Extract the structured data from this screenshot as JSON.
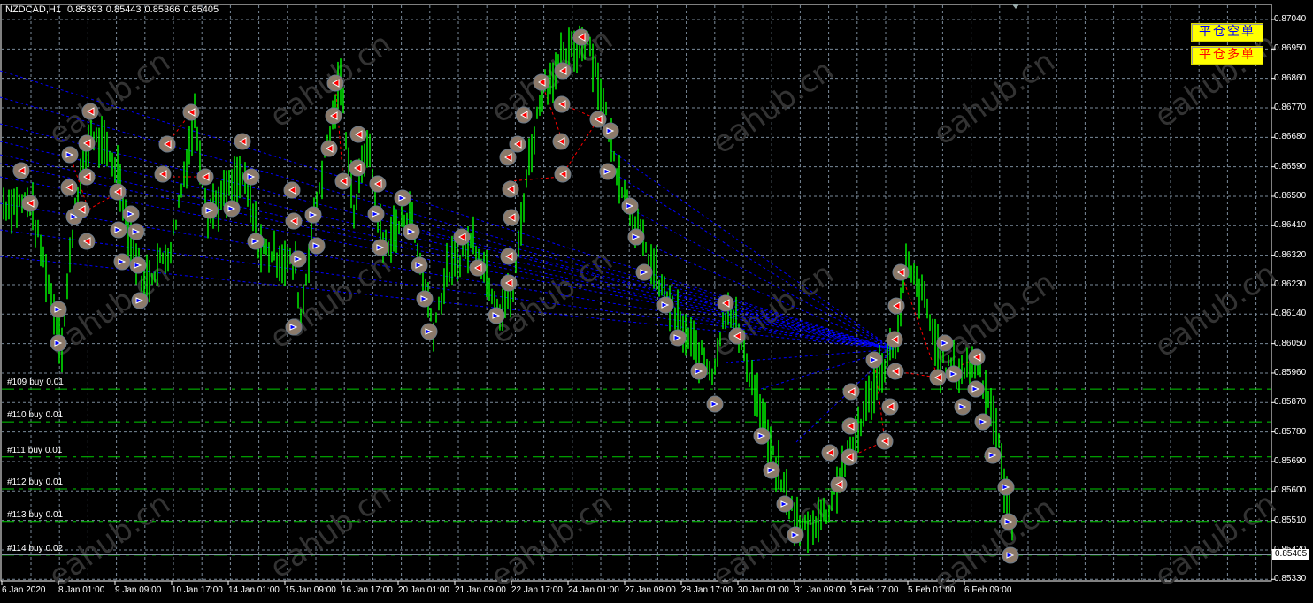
{
  "header": {
    "symbol": "NZDCAD,H1",
    "open": "0.85393",
    "high": "0.85443",
    "low": "0.85366",
    "close": "0.85405"
  },
  "buttons": {
    "close_short": "平仓空单",
    "close_long": "平仓多单"
  },
  "price_axis": [
    "0.87040",
    "0.86950",
    "0.86860",
    "0.86770",
    "0.86680",
    "0.86590",
    "0.86500",
    "0.86410",
    "0.86320",
    "0.86230",
    "0.86140",
    "0.86050",
    "0.85960",
    "0.85870",
    "0.85780",
    "0.85690",
    "0.85600",
    "0.85510",
    "0.85420",
    "0.85330"
  ],
  "current_price": "0.85405",
  "time_axis": [
    "6 Jan 2020",
    "8 Jan 01:00",
    "9 Jan 09:00",
    "10 Jan 17:00",
    "14 Jan 01:00",
    "15 Jan 09:00",
    "16 Jan 17:00",
    "20 Jan 01:00",
    "21 Jan 09:00",
    "22 Jan 17:00",
    "24 Jan 01:00",
    "27 Jan 09:00",
    "28 Jan 17:00",
    "30 Jan 01:00",
    "31 Jan 09:00",
    "3 Feb 17:00",
    "5 Feb 01:00",
    "6 Feb 09:00"
  ],
  "orders": [
    {
      "ticket": "#109",
      "type": "buy",
      "lots": "0.01",
      "price": 0.85911
    },
    {
      "ticket": "#110",
      "type": "buy",
      "lots": "0.01",
      "price": 0.85811
    },
    {
      "ticket": "#111",
      "type": "buy",
      "lots": "0.01",
      "price": 0.85704
    },
    {
      "ticket": "#112",
      "type": "buy",
      "lots": "0.01",
      "price": 0.85606
    },
    {
      "ticket": "#113",
      "type": "buy",
      "lots": "0.01",
      "price": 0.85507
    },
    {
      "ticket": "#114",
      "type": "buy",
      "lots": "0.02",
      "price": 0.85404
    }
  ],
  "watermark": "eahub.cn",
  "colors": {
    "bars": "#00ff00",
    "grid": "#7a8a9a",
    "order_line": "#00cc00",
    "buy_arrow": "#0000ff",
    "sell_arrow": "#ff0000",
    "button_bg": "#ffff00"
  },
  "price_path": [
    [
      0,
      0.86478
    ],
    [
      10,
      0.86478
    ],
    [
      17,
      0.86235
    ],
    [
      22,
      0.86046
    ],
    [
      27,
      0.86478
    ],
    [
      33,
      0.86694
    ],
    [
      43,
      0.86586
    ],
    [
      47,
      0.86397
    ],
    [
      53,
      0.86235
    ],
    [
      63,
      0.86343
    ],
    [
      72,
      0.86748
    ],
    [
      77,
      0.86451
    ],
    [
      90,
      0.86559
    ],
    [
      97,
      0.86343
    ],
    [
      110,
      0.86289
    ],
    [
      112,
      0.86127
    ],
    [
      117,
      0.86451
    ],
    [
      127,
      0.86856
    ],
    [
      132,
      0.86451
    ],
    [
      137,
      0.86667
    ],
    [
      143,
      0.86343
    ],
    [
      153,
      0.86451
    ],
    [
      162,
      0.861
    ],
    [
      167,
      0.86262
    ],
    [
      177,
      0.8637
    ],
    [
      187,
      0.86154
    ],
    [
      192,
      0.86208
    ],
    [
      197,
      0.86559
    ],
    [
      203,
      0.86829
    ],
    [
      210,
      0.8691
    ],
    [
      220,
      0.86991
    ],
    [
      227,
      0.86748
    ],
    [
      230,
      0.86613
    ],
    [
      240,
      0.8637
    ],
    [
      247,
      0.86235
    ],
    [
      257,
      0.86073
    ],
    [
      267,
      0.85965
    ],
    [
      273,
      0.86181
    ],
    [
      283,
      0.85911
    ],
    [
      290,
      0.85695
    ],
    [
      300,
      0.85479
    ],
    [
      310,
      0.85533
    ],
    [
      320,
      0.85749
    ],
    [
      330,
      0.85965
    ],
    [
      337,
      0.86073
    ],
    [
      340,
      0.86289
    ],
    [
      347,
      0.86181
    ],
    [
      353,
      0.85992
    ],
    [
      360,
      0.85965
    ],
    [
      367,
      0.85992
    ],
    [
      373,
      0.8583
    ],
    [
      381,
      0.85425
    ]
  ]
}
